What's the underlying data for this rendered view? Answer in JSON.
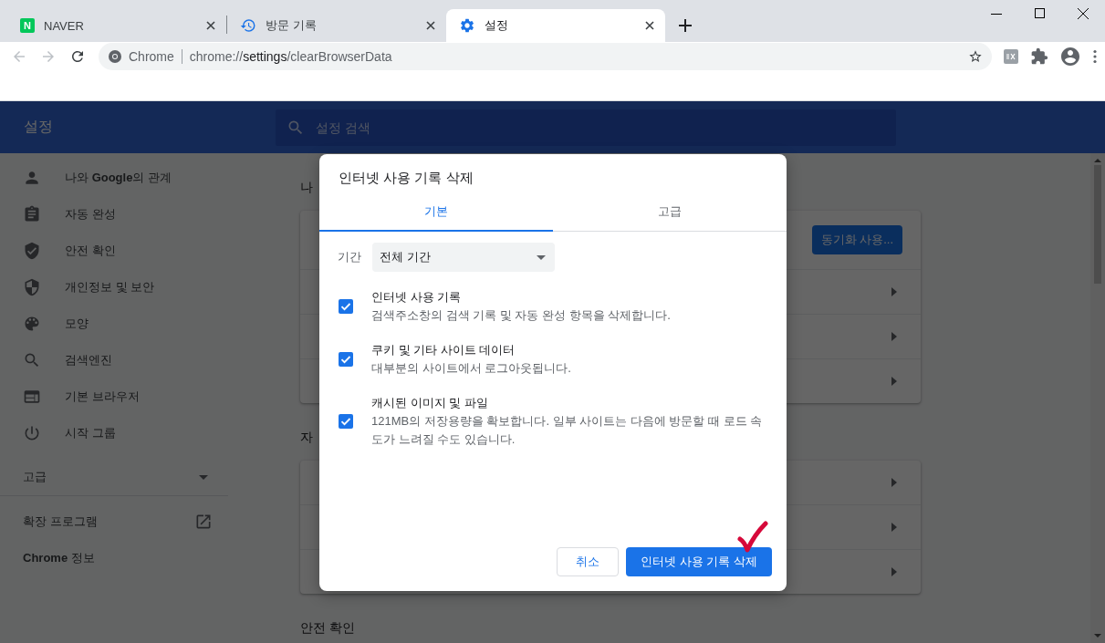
{
  "tabs": [
    {
      "label": "NAVER",
      "selected": false,
      "kind": "letter",
      "favicon_text": "N"
    },
    {
      "label": "방문 기록",
      "selected": false,
      "kind": "history"
    },
    {
      "label": "설정",
      "selected": true,
      "kind": "settings"
    }
  ],
  "omnibox": {
    "site_label": "Chrome",
    "url_scheme": "chrome://",
    "url_host": "settings",
    "url_path": "/clearBrowserData"
  },
  "settings_header": {
    "title": "설정",
    "search": {
      "placeholder": "설정 검색"
    }
  },
  "sidebar": {
    "items": [
      {
        "label": "나와 **Google**의 관계",
        "kind": "person"
      },
      {
        "label": "자동 완성",
        "kind": "clipboard"
      },
      {
        "label": "안전 확인",
        "kind": "shield-check"
      },
      {
        "label": "개인정보 및 보안",
        "kind": "shield"
      },
      {
        "label": "모양",
        "kind": "palette"
      },
      {
        "label": "검색엔진",
        "kind": "search"
      },
      {
        "label": "기본 브라우저",
        "kind": "browser"
      },
      {
        "label": "시작 그룹",
        "kind": "power"
      }
    ],
    "advanced": {
      "label": "고급",
      "expanded": false
    },
    "extensions": "확장 프로그램",
    "about": "**Chrome** 정보"
  },
  "sections": [
    {
      "title": "나",
      "rows": [
        {
          "kind": "button",
          "button": "동기화 사용..."
        },
        {
          "kind": "link"
        },
        {
          "kind": "link"
        },
        {
          "kind": "link"
        }
      ]
    },
    {
      "title": "자",
      "rows": [
        {
          "kind": "link"
        },
        {
          "kind": "link"
        },
        {
          "kind": "link"
        }
      ]
    },
    {
      "title": "안전 확인"
    }
  ],
  "dialog": {
    "title": "인터넷 사용 기록 삭제",
    "tabs": [
      {
        "label": "기본",
        "selected": true
      },
      {
        "label": "고급",
        "selected": false
      }
    ],
    "time_range": {
      "label": "기간",
      "value": "전체 기간"
    },
    "options": [
      {
        "title": "인터넷 사용 기록",
        "description": "검색주소창의 검색 기록 및 자동 완성 항목을 삭제합니다.",
        "checked": true
      },
      {
        "title": "쿠키 및 기타 사이트 데이터",
        "description": "대부분의 사이트에서 로그아웃됩니다.",
        "checked": true
      },
      {
        "title": "캐시된 이미지 및 파일",
        "description": "121MB의 저장용량을 확보합니다. 일부 사이트는 다음에 방문할 때 로드 속도가 느려질 수도 있습니다.",
        "checked": true
      }
    ],
    "buttons": [
      {
        "label": "취소",
        "kind": "secondary"
      },
      {
        "label": "인터넷 사용 기록 삭제",
        "kind": "primary"
      }
    ]
  }
}
